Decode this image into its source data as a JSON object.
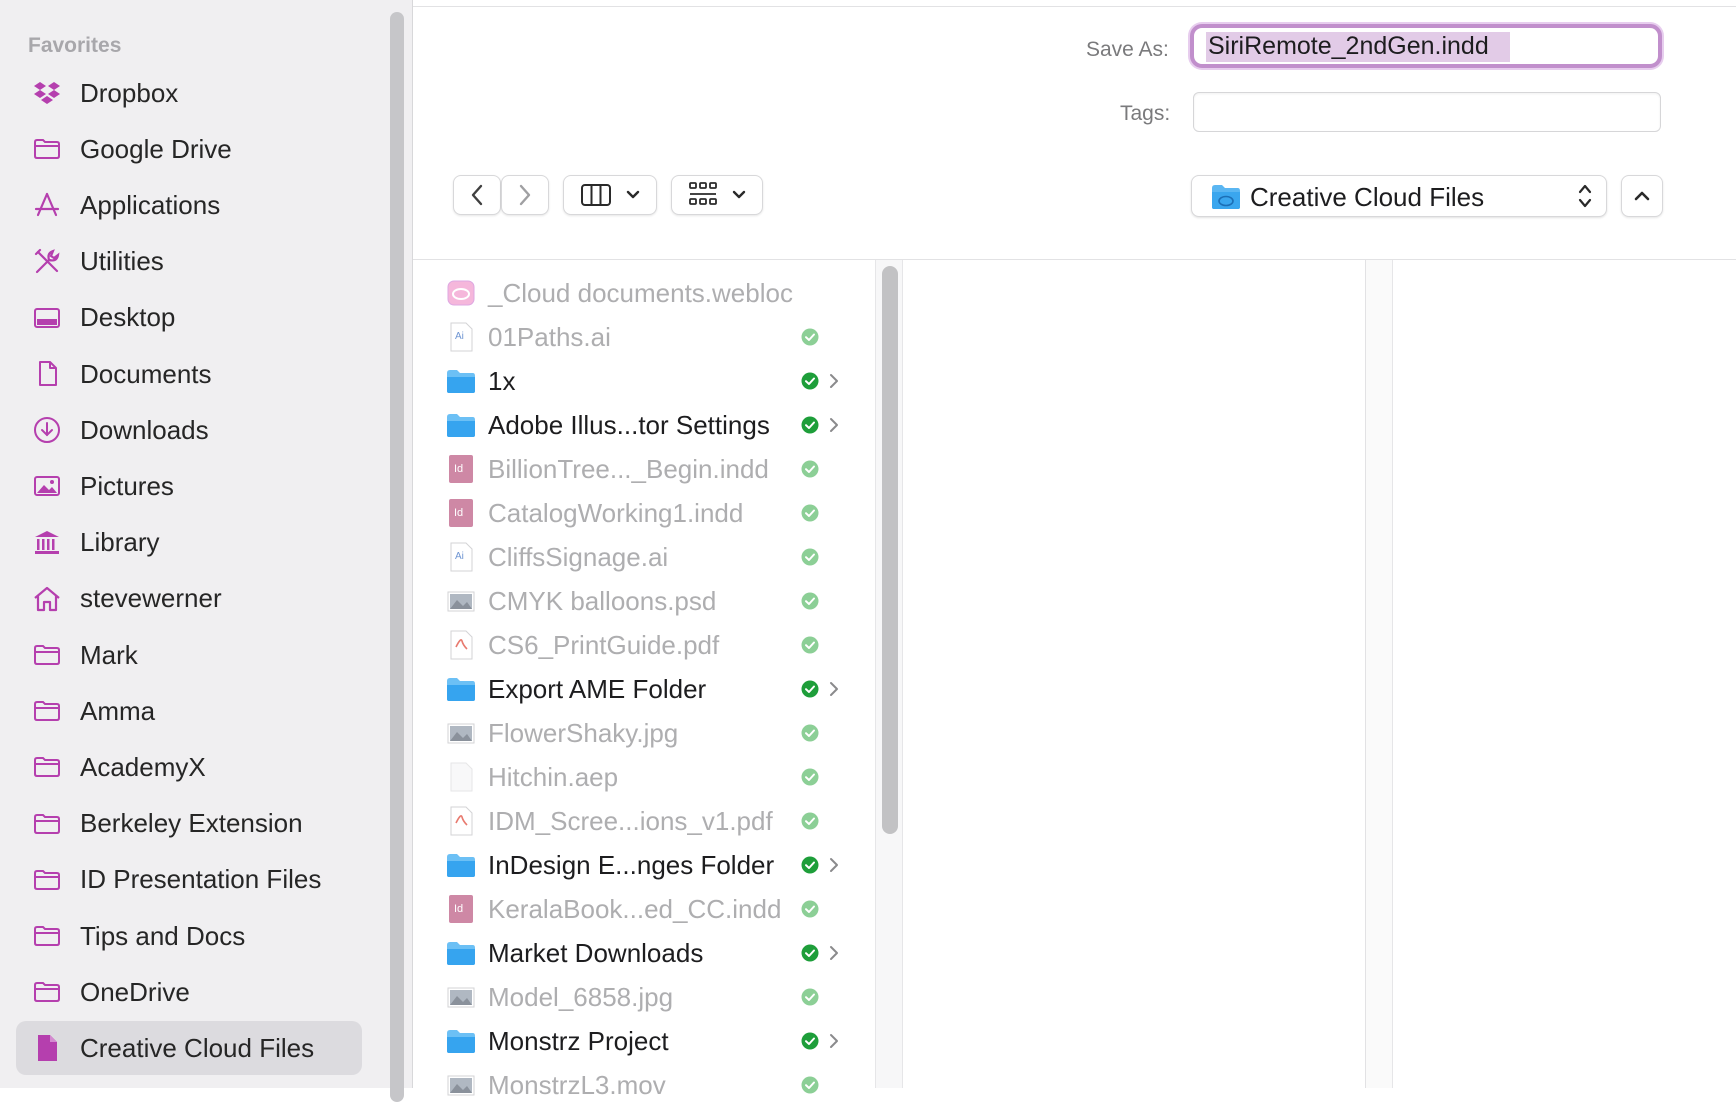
{
  "sidebar": {
    "heading": "Favorites",
    "items": [
      {
        "label": "Dropbox",
        "icon": "dropbox-icon"
      },
      {
        "label": "Google Drive",
        "icon": "folder-icon"
      },
      {
        "label": "Applications",
        "icon": "applications-icon"
      },
      {
        "label": "Utilities",
        "icon": "utilities-icon"
      },
      {
        "label": "Desktop",
        "icon": "desktop-icon"
      },
      {
        "label": "Documents",
        "icon": "document-icon"
      },
      {
        "label": "Downloads",
        "icon": "downloads-icon"
      },
      {
        "label": "Pictures",
        "icon": "pictures-icon"
      },
      {
        "label": "Library",
        "icon": "library-icon"
      },
      {
        "label": "stevewerner",
        "icon": "home-icon"
      },
      {
        "label": "Mark",
        "icon": "folder-icon"
      },
      {
        "label": "Amma",
        "icon": "folder-icon"
      },
      {
        "label": "AcademyX",
        "icon": "folder-icon"
      },
      {
        "label": "Berkeley Extension",
        "icon": "folder-icon"
      },
      {
        "label": "ID Presentation Files",
        "icon": "folder-icon"
      },
      {
        "label": "Tips and Docs",
        "icon": "folder-icon"
      },
      {
        "label": "OneDrive",
        "icon": "folder-icon"
      },
      {
        "label": "Creative Cloud Files",
        "icon": "creative-cloud-doc-icon",
        "selected": true
      }
    ]
  },
  "save_dialog": {
    "save_as_label": "Save As:",
    "save_as_value": "SiriRemote_2ndGen.indd",
    "tags_label": "Tags:",
    "tags_value": "",
    "location": "Creative Cloud Files"
  },
  "files": [
    {
      "name": "_Cloud documents.webloc",
      "type": "webloc",
      "dim": true,
      "status": "none",
      "folder": false
    },
    {
      "name": "01Paths.ai",
      "type": "ai",
      "dim": true,
      "status": "synced-light",
      "folder": false
    },
    {
      "name": "1x",
      "type": "folder",
      "dim": false,
      "status": "synced",
      "folder": true
    },
    {
      "name": "Adobe Illus...tor Settings",
      "type": "folder",
      "dim": false,
      "status": "synced",
      "folder": true
    },
    {
      "name": "BillionTree..._Begin.indd",
      "type": "indd",
      "dim": true,
      "status": "synced-light",
      "folder": false
    },
    {
      "name": "CatalogWorking1.indd",
      "type": "indd",
      "dim": true,
      "status": "synced-light",
      "folder": false
    },
    {
      "name": "CliffsSignage.ai",
      "type": "ai",
      "dim": true,
      "status": "synced-light",
      "folder": false
    },
    {
      "name": "CMYK balloons.psd",
      "type": "image",
      "dim": true,
      "status": "synced-light",
      "folder": false
    },
    {
      "name": "CS6_PrintGuide.pdf",
      "type": "pdf",
      "dim": true,
      "status": "synced-light",
      "folder": false
    },
    {
      "name": "Export AME Folder",
      "type": "folder",
      "dim": false,
      "status": "synced",
      "folder": true
    },
    {
      "name": "FlowerShaky.jpg",
      "type": "image",
      "dim": true,
      "status": "synced-light",
      "folder": false
    },
    {
      "name": "Hitchin.aep",
      "type": "blank",
      "dim": true,
      "status": "synced-light",
      "folder": false
    },
    {
      "name": "IDM_Scree...ions_v1.pdf",
      "type": "pdf",
      "dim": true,
      "status": "synced-light",
      "folder": false
    },
    {
      "name": "InDesign E...nges Folder",
      "type": "folder",
      "dim": false,
      "status": "synced",
      "folder": true
    },
    {
      "name": "KeralaBook...ed_CC.indd",
      "type": "indd",
      "dim": true,
      "status": "synced-light",
      "folder": false
    },
    {
      "name": "Market Downloads",
      "type": "folder",
      "dim": false,
      "status": "synced",
      "folder": true
    },
    {
      "name": "Model_6858.jpg",
      "type": "image",
      "dim": true,
      "status": "synced-light",
      "folder": false
    },
    {
      "name": "Monstrz Project",
      "type": "folder",
      "dim": false,
      "status": "synced",
      "folder": true
    },
    {
      "name": "MonstrzL3.mov",
      "type": "image",
      "dim": true,
      "status": "synced-light",
      "folder": false
    }
  ],
  "colors": {
    "accent": "#b53fae",
    "sync_green": "#1e9e3a",
    "sync_green_light": "#8ccf96",
    "folder_blue": "#36a4ef"
  }
}
